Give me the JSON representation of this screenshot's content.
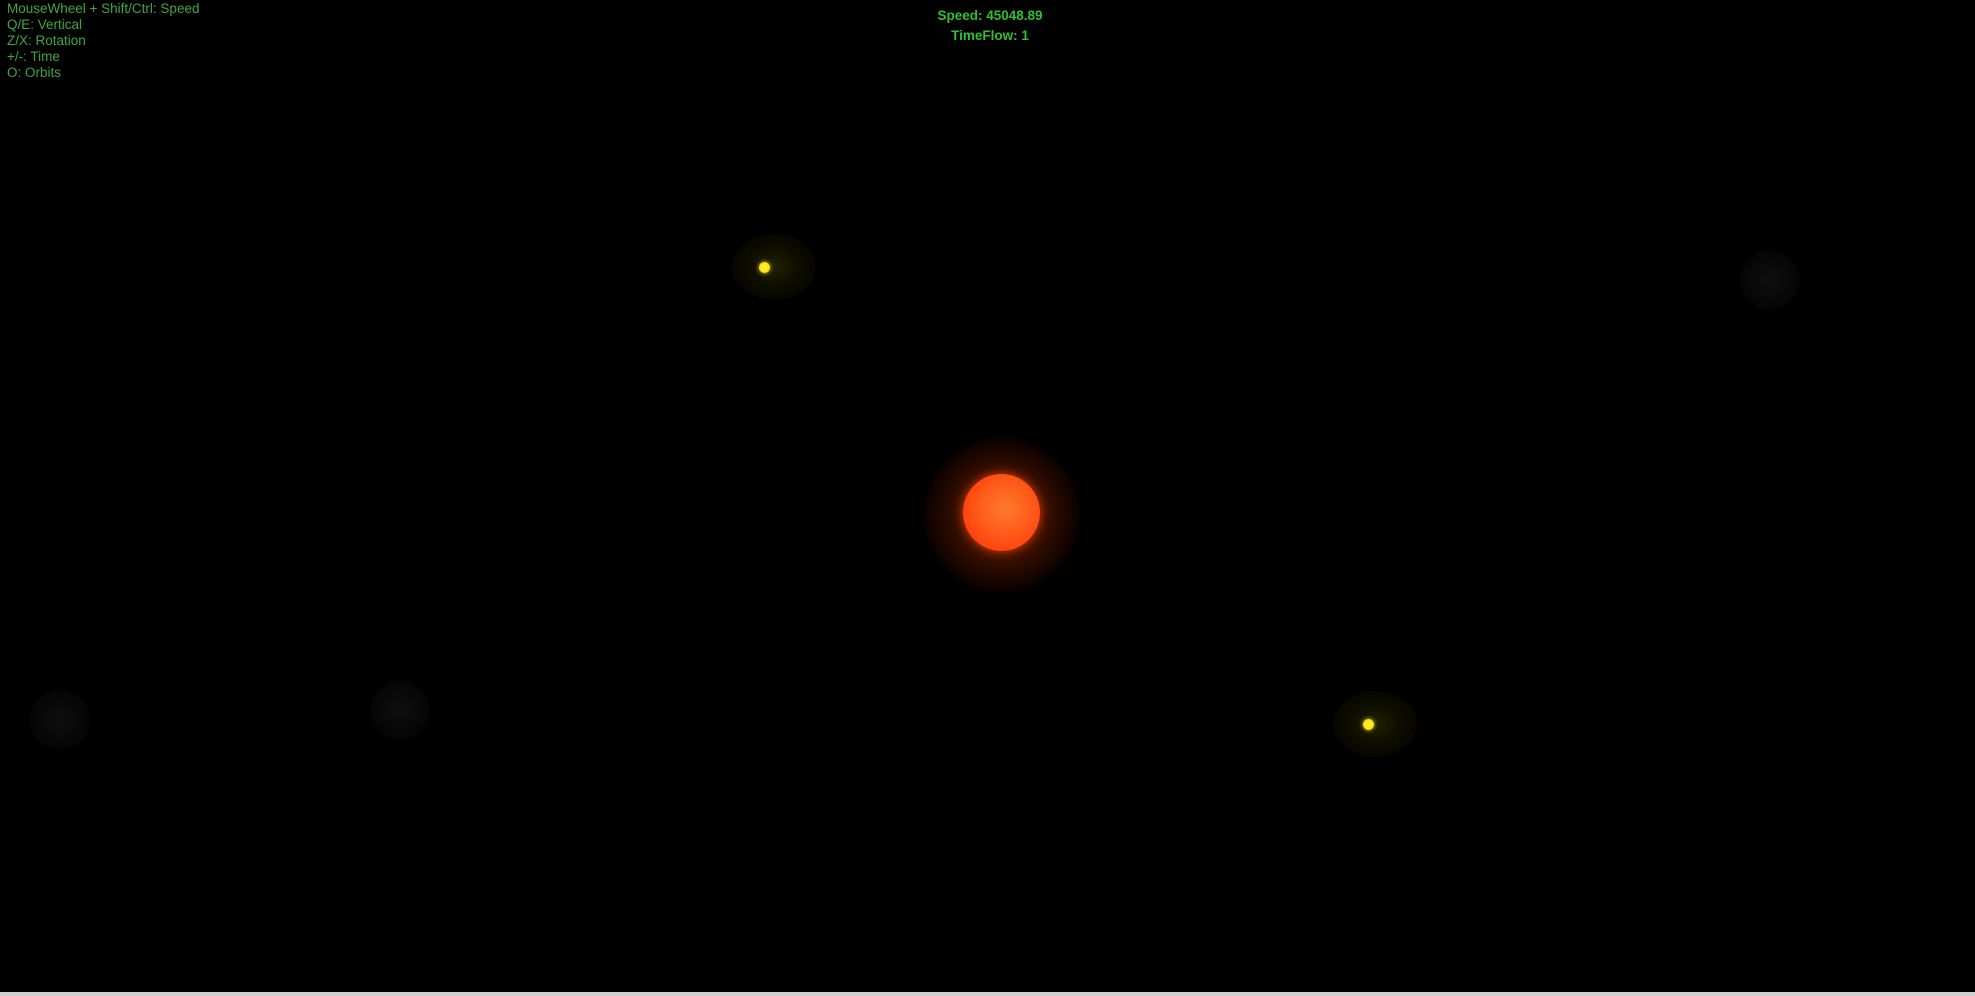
{
  "help": {
    "speed_hint": "MouseWheel + Shift/Ctrl: Speed",
    "vertical_hint": "Q/E: Vertical",
    "rotation_hint": "Z/X: Rotation",
    "time_hint": "+/-: Time",
    "orbits_hint": "O: Orbits"
  },
  "hud": {
    "speed": "Speed: 45048.89",
    "timeflow": "TimeFlow: 1"
  },
  "colors": {
    "background": "#000000",
    "help_text": "#3fa63f",
    "hud_text": "#2fbf2f",
    "sun": "#ff4a10",
    "planet": "#ffe400"
  },
  "scene": {
    "bodies": [
      {
        "name": "sun",
        "kind": "star"
      },
      {
        "name": "planet-1",
        "kind": "planet"
      },
      {
        "name": "planet-2",
        "kind": "planet"
      }
    ]
  }
}
